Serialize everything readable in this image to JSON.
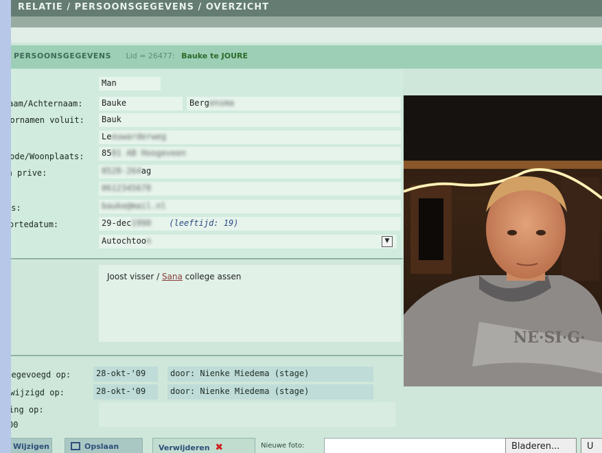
{
  "titlebar": {
    "text": "RELATIE / PERSOONSGEGEVENS / OVERZICHT"
  },
  "section": {
    "title": "PERSOONSGEGEVENS",
    "id_text": "Lid = 26477:",
    "name": "Bauke te JOURE"
  },
  "form": {
    "gender_value": "Man",
    "labels": {
      "name": "Roepnaam/Achternaam:",
      "full_names": "Voornamen voluit:",
      "zip_city": "Postcode/Woonplaats:",
      "phone_private": "Telefoon prive:",
      "email": "E-mailadres:",
      "birthdate": "Geboortedatum:"
    },
    "first_name": "Bauke",
    "last_name": "Berg",
    "full_names": "Bauk",
    "address": "Le",
    "zip_city": "85",
    "phone_private": "ag",
    "phone2": "",
    "email": "",
    "birthdate": "29-dec",
    "age": "(leeftijd: 19)",
    "origin": "Autochtoo"
  },
  "notes": {
    "before": "Joost visser / ",
    "underlined": "Sana",
    "after": " college assen"
  },
  "meta": {
    "added_label": "Toegevoegd op:",
    "added_date": "28-okt-'09",
    "added_by_label": "door:",
    "added_by": "Nienke Miedema (stage)",
    "changed_label": "Gewijzigd op:",
    "changed_date": "28-okt-'09",
    "changed_by_label": "door:",
    "changed_by": "Nienke Miedema (stage)",
    "extra_label": "Inschrijving op:",
    "extra_value": "00"
  },
  "toolbar": {
    "back_label": "Wijzigen",
    "save_label": "Opslaan",
    "delete_label": "Verwijderen",
    "new_photo_label": "Nieuwe foto:",
    "browse_label": "Bladeren...",
    "upload_label": "U"
  },
  "colors": {
    "page_bg": "#cfe7da",
    "header_bg": "#9ccfb6",
    "titlebar_bg": "#647c72"
  }
}
